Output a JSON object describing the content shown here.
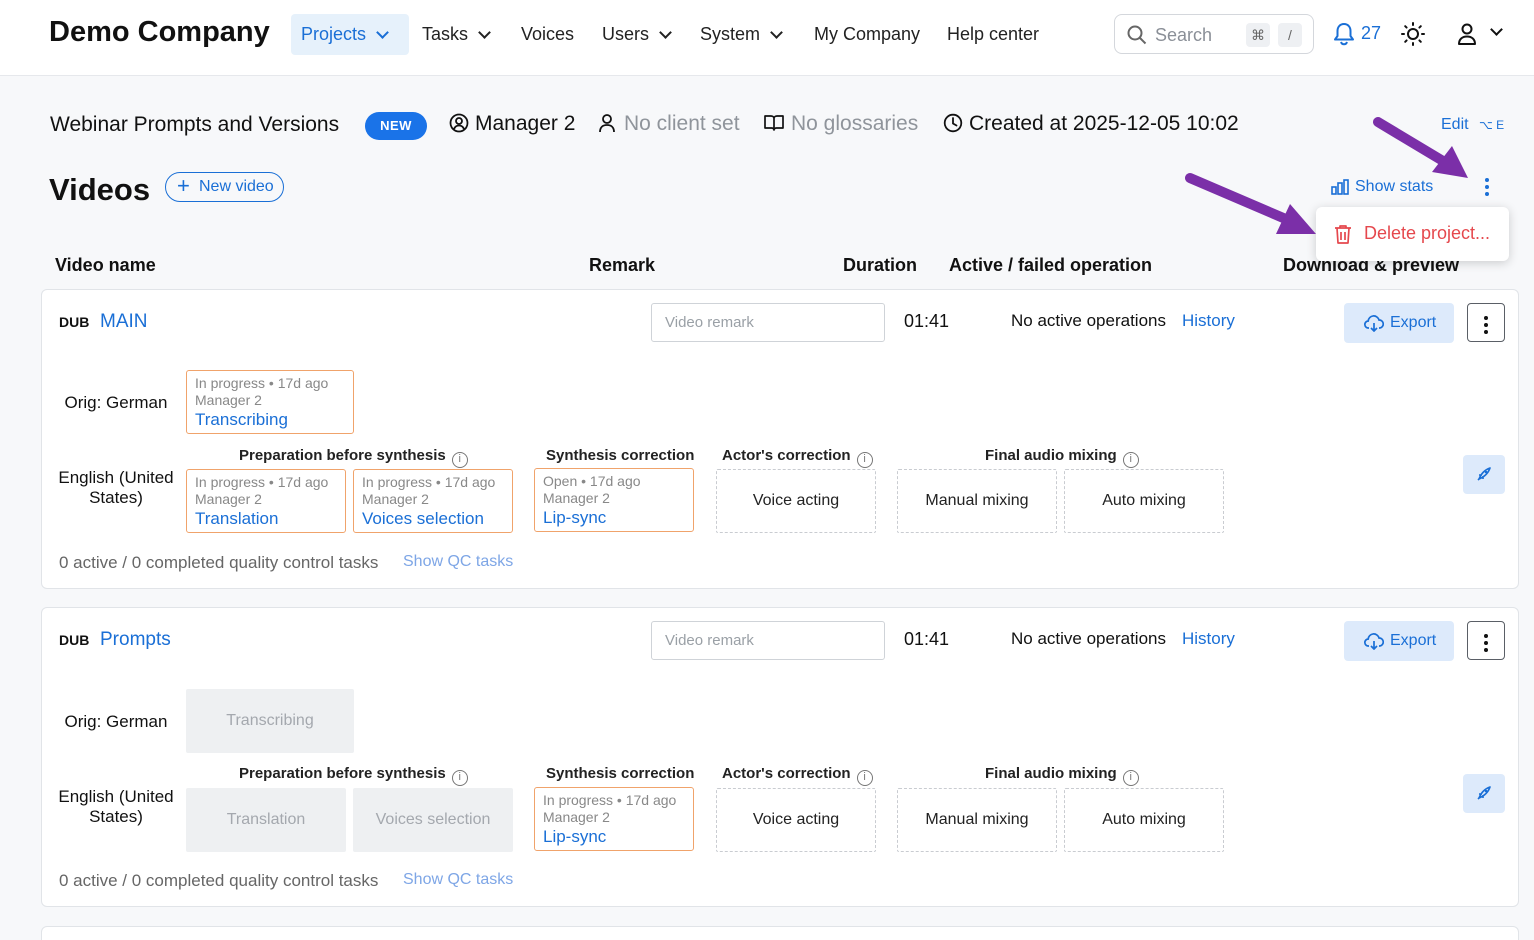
{
  "header": {
    "brand": "Demo Company",
    "nav": [
      {
        "label": "Projects",
        "has_dropdown": true,
        "active": true
      },
      {
        "label": "Tasks",
        "has_dropdown": true
      },
      {
        "label": "Voices"
      },
      {
        "label": "Users",
        "has_dropdown": true
      },
      {
        "label": "System",
        "has_dropdown": true
      },
      {
        "label": "My Company"
      },
      {
        "label": "Help center"
      }
    ],
    "search_placeholder": "Search",
    "search_shortcut_1": "⌘",
    "search_shortcut_2": "/",
    "notification_count": "27",
    "accent": "#1a6fd6"
  },
  "project": {
    "title": "Webinar Prompts and Versions",
    "badge": "NEW",
    "manager": "Manager 2",
    "client": "No client set",
    "glossaries": "No glossaries",
    "created": "Created at 2025-12-05 10:02",
    "edit_label": "Edit",
    "edit_shortcut": "⌥ E"
  },
  "videos_section": {
    "heading": "Videos",
    "new_video_label": "New video",
    "show_stats_label": "Show stats",
    "menu": {
      "delete_label": "Delete project..."
    },
    "columns": [
      "Video name",
      "Remark",
      "Duration",
      "Active / failed operation",
      "Download & preview"
    ]
  },
  "groups": {
    "prep": "Preparation before synthesis",
    "synth": "Synthesis correction",
    "actor": "Actor's correction",
    "final": "Final audio mixing"
  },
  "videos": [
    {
      "type": "DUB",
      "name": "MAIN",
      "remark_placeholder": "Video remark",
      "duration": "01:41",
      "operations": "No active operations",
      "history_label": "History",
      "export_label": "Export",
      "orig_label": "Orig: German",
      "orig_task": {
        "status": "In progress • 17d ago",
        "user": "Manager 2",
        "name": "Transcribing"
      },
      "target_label": "English (United States)",
      "translation": {
        "status": "In progress • 17d ago",
        "user": "Manager 2",
        "name": "Translation"
      },
      "voices": {
        "status": "In progress • 17d ago",
        "user": "Manager 2",
        "name": "Voices selection"
      },
      "lipsync": {
        "status": "Open • 17d ago",
        "user": "Manager 2",
        "name": "Lip-sync"
      },
      "voice_acting": "Voice acting",
      "manual_mixing": "Manual mixing",
      "auto_mixing": "Auto mixing",
      "qc": "0 active / 0 completed quality control tasks",
      "show_qc_label": "Show QC tasks"
    },
    {
      "type": "DUB",
      "name": "Prompts",
      "remark_placeholder": "Video remark",
      "duration": "01:41",
      "operations": "No active operations",
      "history_label": "History",
      "export_label": "Export",
      "orig_label": "Orig: German",
      "orig_task_disabled": "Transcribing",
      "target_label": "English (United States)",
      "translation_disabled": "Translation",
      "voices_disabled": "Voices selection",
      "lipsync": {
        "status": "In progress • 17d ago",
        "user": "Manager 2",
        "name": "Lip-sync"
      },
      "voice_acting": "Voice acting",
      "manual_mixing": "Manual mixing",
      "auto_mixing": "Auto mixing",
      "qc": "0 active / 0 completed quality control tasks",
      "show_qc_label": "Show QC tasks"
    }
  ],
  "annotation_color": "#7b2fa8"
}
